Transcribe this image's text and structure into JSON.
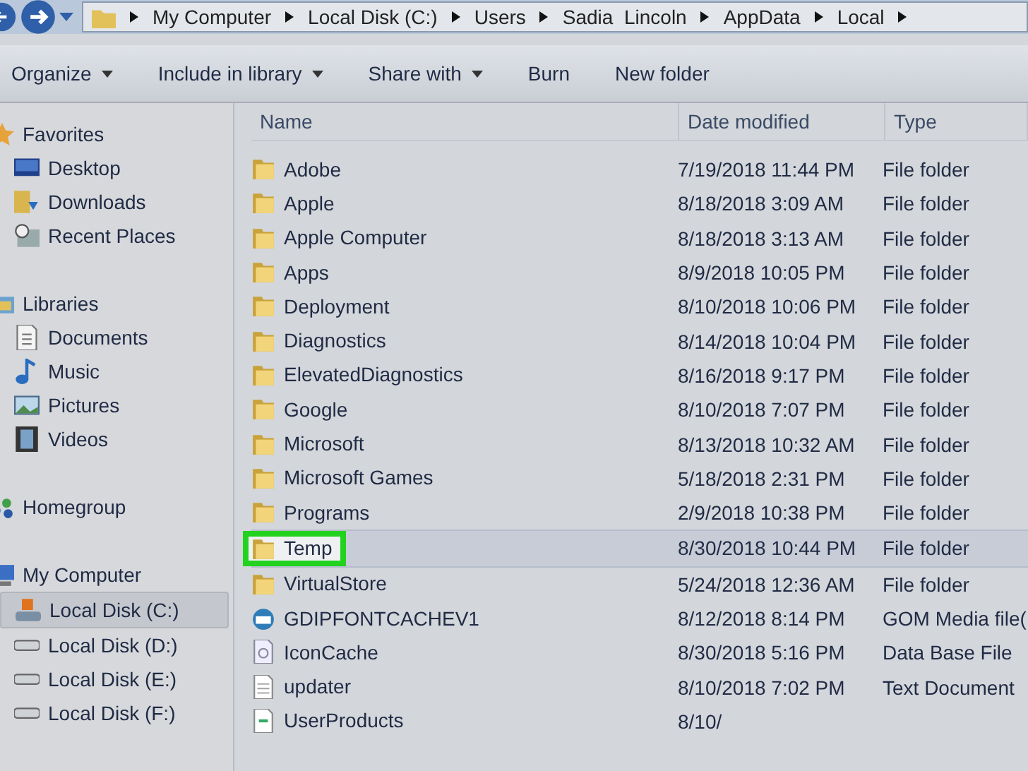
{
  "address_bar": {
    "crumbs": [
      "My Computer",
      "Local Disk (C:)",
      "Users",
      "Sadia  Lincoln",
      "AppData",
      "Local"
    ]
  },
  "toolbar": [
    {
      "label": "Organize",
      "dropdown": true
    },
    {
      "label": "Include in library",
      "dropdown": true
    },
    {
      "label": "Share with",
      "dropdown": true
    },
    {
      "label": "Burn",
      "dropdown": false
    },
    {
      "label": "New folder",
      "dropdown": false
    }
  ],
  "sidebar": {
    "groups": [
      {
        "label": "Favorites",
        "kind": "star",
        "children": [
          {
            "label": "Desktop",
            "kind": "desktop",
            "selected": false
          },
          {
            "label": "Downloads",
            "kind": "downloads",
            "selected": false
          },
          {
            "label": "Recent Places",
            "kind": "recent",
            "selected": false
          }
        ]
      },
      {
        "label": "Libraries",
        "kind": "library",
        "children": [
          {
            "label": "Documents",
            "kind": "document",
            "selected": false
          },
          {
            "label": "Music",
            "kind": "music",
            "selected": false
          },
          {
            "label": "Pictures",
            "kind": "pictures",
            "selected": false
          },
          {
            "label": "Videos",
            "kind": "videos",
            "selected": false
          }
        ]
      },
      {
        "label": "Homegroup",
        "kind": "homegroup"
      },
      {
        "label": "My Computer",
        "kind": "computer",
        "children": [
          {
            "label": "Local Disk (C:)",
            "kind": "system-disk",
            "selected": true
          },
          {
            "label": "Local Disk (D:)",
            "kind": "disk",
            "selected": false
          },
          {
            "label": "Local Disk (E:)",
            "kind": "disk",
            "selected": false
          },
          {
            "label": "Local Disk (F:)",
            "kind": "disk",
            "selected": false
          }
        ]
      }
    ]
  },
  "table": {
    "columns": [
      "Name",
      "Date modified",
      "Type"
    ],
    "rows": [
      {
        "name": "Adobe",
        "date": "7/19/2018 11:44 PM",
        "type": "File folder",
        "kind": "folder",
        "selected": false,
        "highlighted": false
      },
      {
        "name": "Apple",
        "date": "8/18/2018 3:09 AM",
        "type": "File folder",
        "kind": "folder",
        "selected": false,
        "highlighted": false
      },
      {
        "name": "Apple Computer",
        "date": "8/18/2018 3:13 AM",
        "type": "File folder",
        "kind": "folder",
        "selected": false,
        "highlighted": false
      },
      {
        "name": "Apps",
        "date": "8/9/2018 10:05 PM",
        "type": "File folder",
        "kind": "folder",
        "selected": false,
        "highlighted": false
      },
      {
        "name": "Deployment",
        "date": "8/10/2018 10:06 PM",
        "type": "File folder",
        "kind": "folder",
        "selected": false,
        "highlighted": false
      },
      {
        "name": "Diagnostics",
        "date": "8/14/2018 10:04 PM",
        "type": "File folder",
        "kind": "folder",
        "selected": false,
        "highlighted": false
      },
      {
        "name": "ElevatedDiagnostics",
        "date": "8/16/2018 9:17 PM",
        "type": "File folder",
        "kind": "folder",
        "selected": false,
        "highlighted": false
      },
      {
        "name": "Google",
        "date": "8/10/2018 7:07 PM",
        "type": "File folder",
        "kind": "folder",
        "selected": false,
        "highlighted": false
      },
      {
        "name": "Microsoft",
        "date": "8/13/2018 10:32 AM",
        "type": "File folder",
        "kind": "folder",
        "selected": false,
        "highlighted": false
      },
      {
        "name": "Microsoft Games",
        "date": "5/18/2018 2:31 PM",
        "type": "File folder",
        "kind": "folder",
        "selected": false,
        "highlighted": false
      },
      {
        "name": "Programs",
        "date": "2/9/2018 10:38 PM",
        "type": "File folder",
        "kind": "folder",
        "selected": false,
        "highlighted": false
      },
      {
        "name": "Temp",
        "date": "8/30/2018 10:44 PM",
        "type": "File folder",
        "kind": "folder",
        "selected": true,
        "highlighted": true
      },
      {
        "name": "VirtualStore",
        "date": "5/24/2018 12:36 AM",
        "type": "File folder",
        "kind": "folder",
        "selected": false,
        "highlighted": false
      },
      {
        "name": "GDIPFONTCACHEV1",
        "date": "8/12/2018 8:14 PM",
        "type": "GOM Media file(",
        "kind": "media",
        "selected": false,
        "highlighted": false
      },
      {
        "name": "IconCache",
        "date": "8/30/2018 5:16 PM",
        "type": "Data Base File",
        "kind": "database",
        "selected": false,
        "highlighted": false
      },
      {
        "name": "updater",
        "date": "8/10/2018 7:02 PM",
        "type": "Text Document",
        "kind": "text",
        "selected": false,
        "highlighted": false
      },
      {
        "name": "UserProducts",
        "date": "8/10/",
        "kind": "config",
        "selected": false,
        "highlighted": false
      }
    ]
  }
}
